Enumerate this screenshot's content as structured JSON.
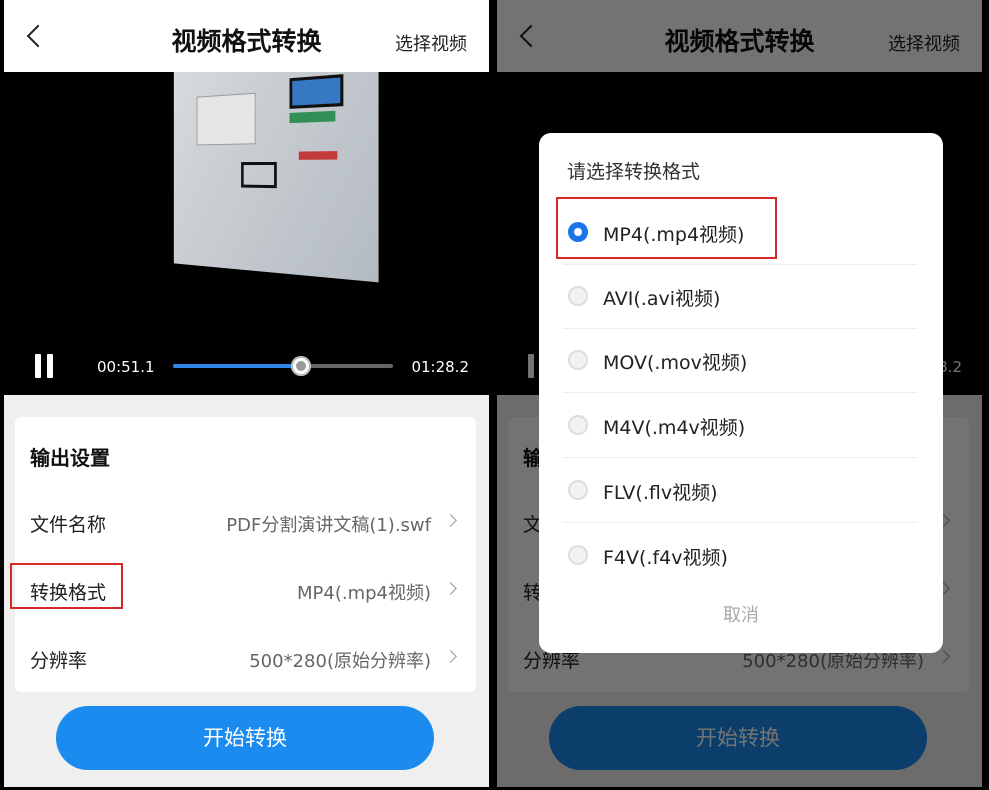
{
  "app": {
    "title": "视频格式转换",
    "select_video": "选择视频"
  },
  "player": {
    "current_time": "00:51.1",
    "total_time": "01:28.2",
    "progress": 0.58
  },
  "settings": {
    "heading": "输出设置",
    "rows": [
      {
        "label": "文件名称",
        "value": "PDF分割演讲文稿(1).swf"
      },
      {
        "label": "转换格式",
        "value": "MP4(.mp4视频)"
      },
      {
        "label": "分辨率",
        "value": "500*280(原始分辨率)"
      }
    ]
  },
  "start_button": "开始转换",
  "dialog": {
    "title": "请选择转换格式",
    "options": [
      {
        "label": "MP4(.mp4视频)",
        "selected": true
      },
      {
        "label": "AVI(.avi视频)",
        "selected": false
      },
      {
        "label": "MOV(.mov视频)",
        "selected": false
      },
      {
        "label": "M4V(.m4v视频)",
        "selected": false
      },
      {
        "label": "FLV(.flv视频)",
        "selected": false
      },
      {
        "label": "F4V(.f4v视频)",
        "selected": false
      }
    ],
    "cancel": "取消"
  },
  "colors": {
    "accent": "#1b8bf0",
    "highlight": "#d42a2a"
  }
}
